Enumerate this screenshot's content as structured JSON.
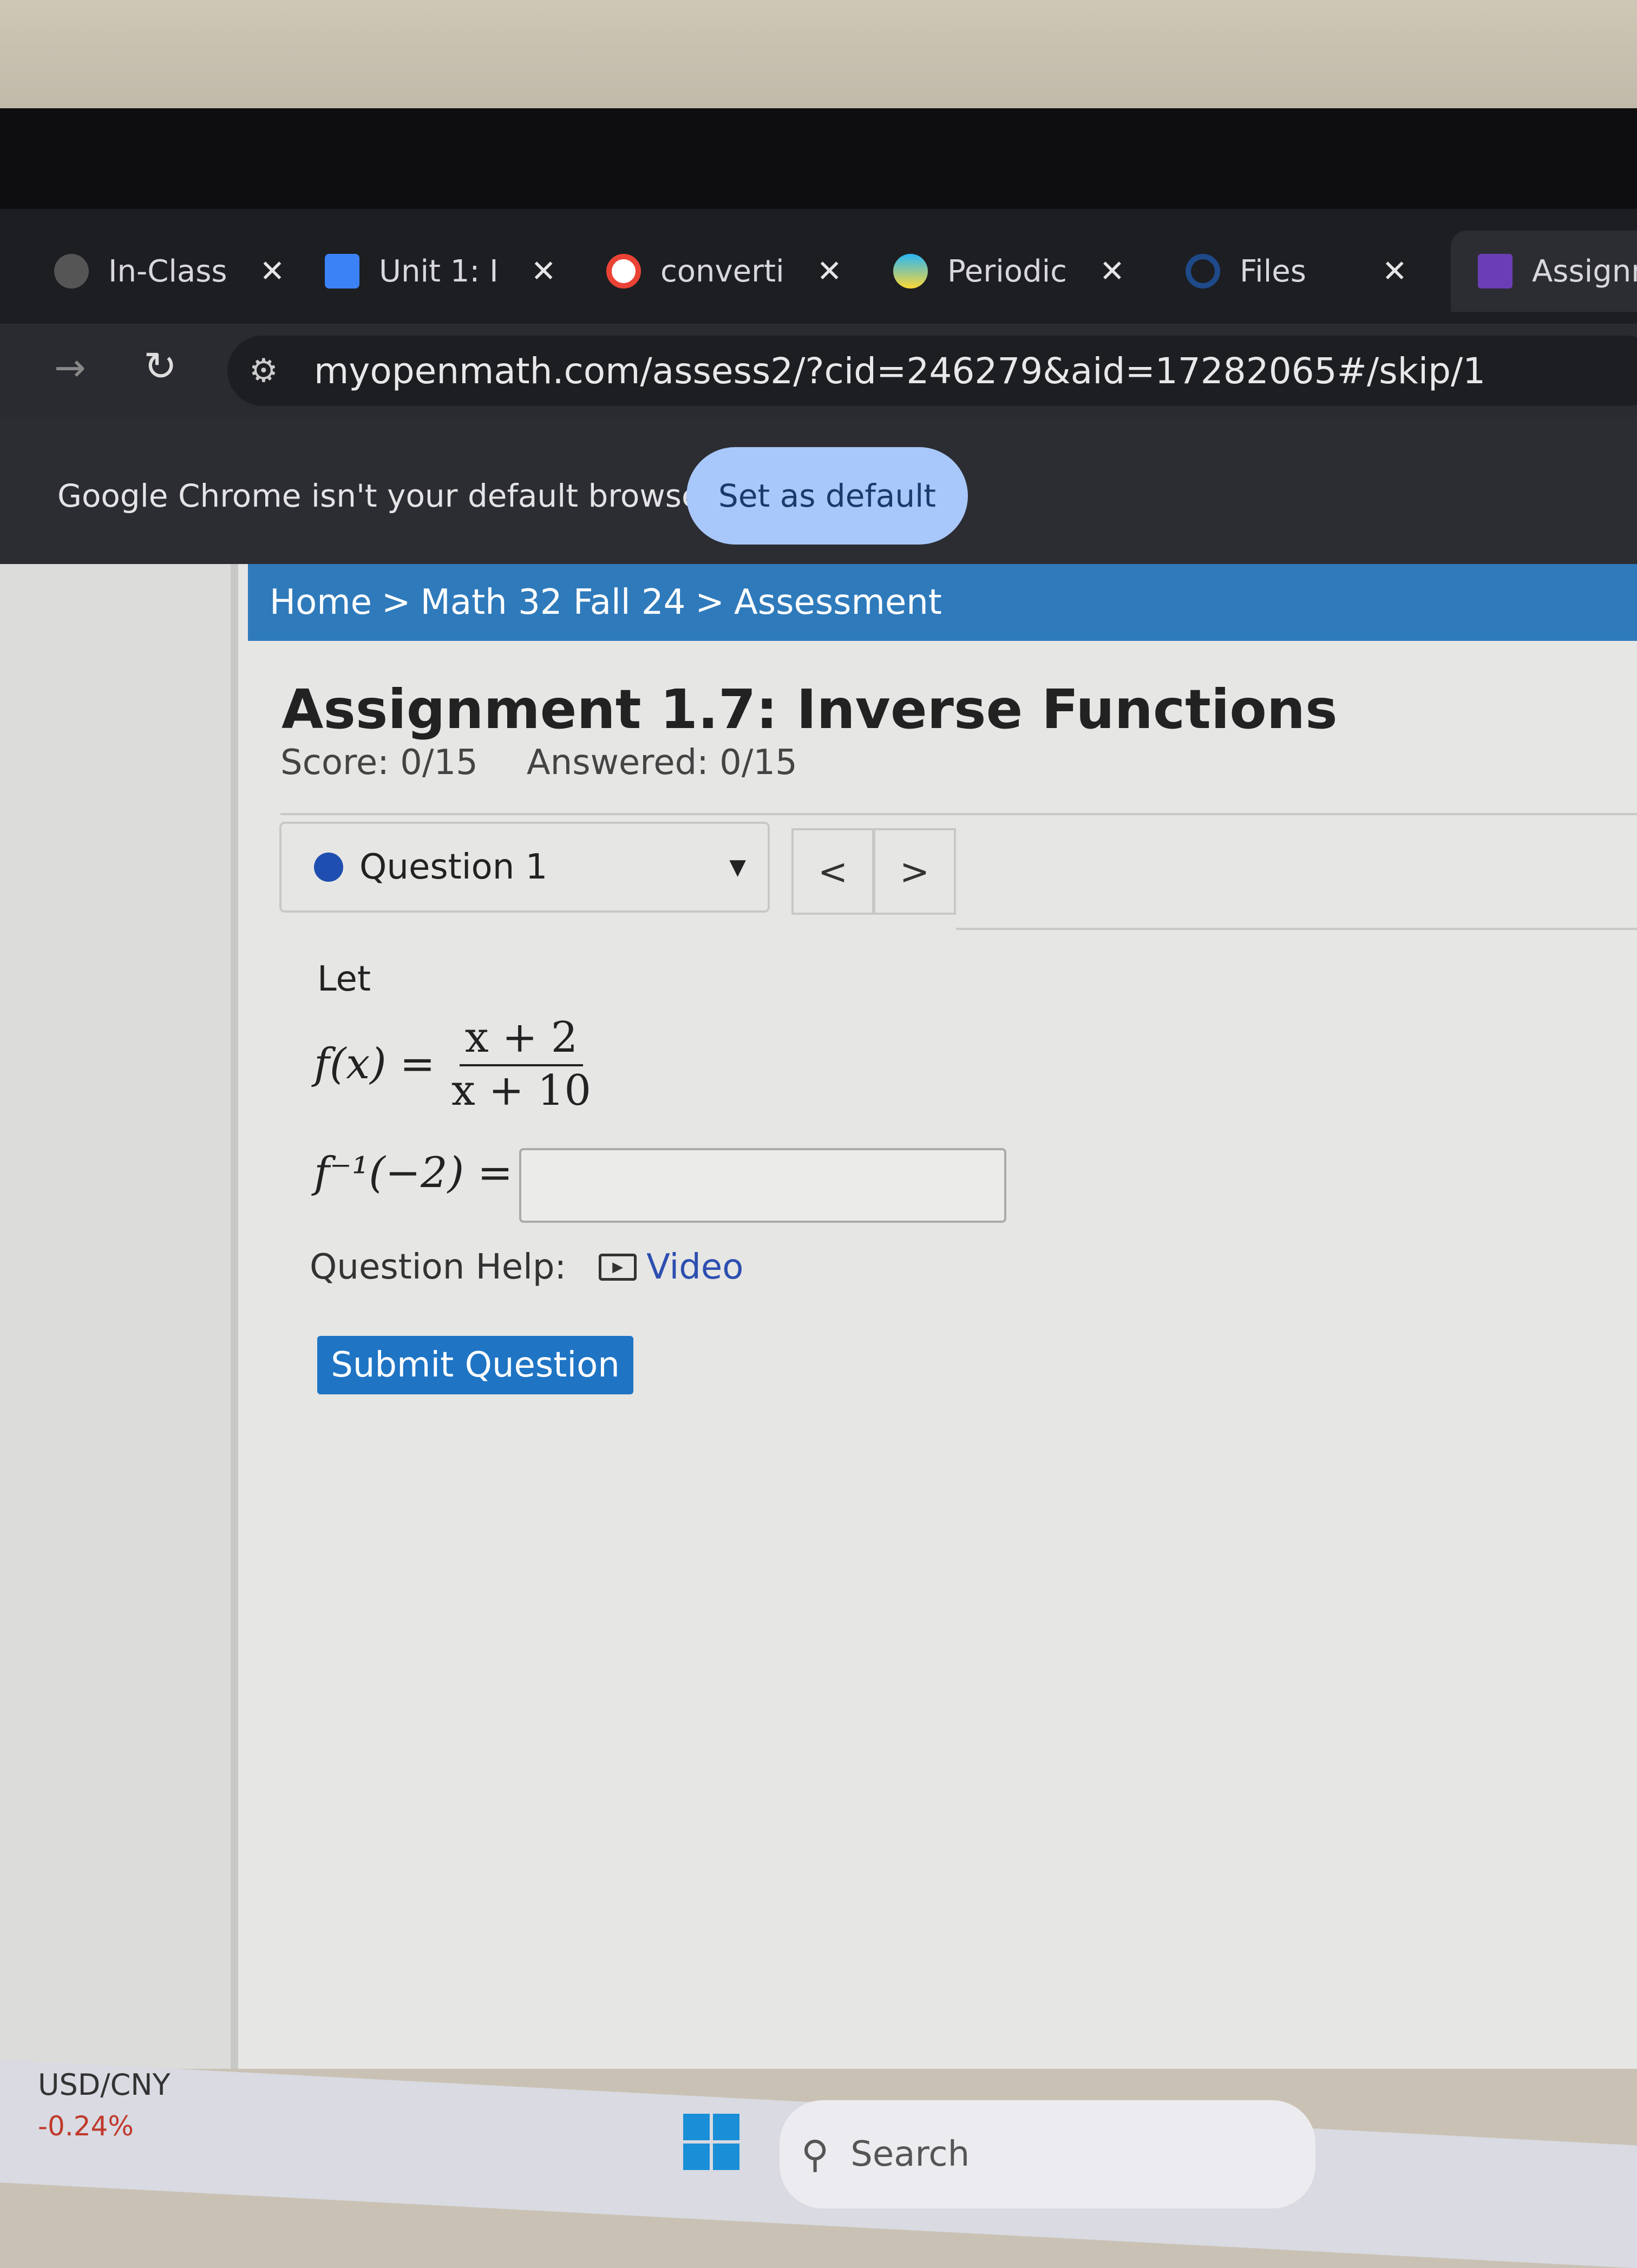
{
  "browser": {
    "tabs": [
      {
        "label": "In-Class",
        "icon": "globe-icon",
        "active": false
      },
      {
        "label": "Unit 1: I",
        "icon": "docs-icon",
        "active": false
      },
      {
        "label": "converti",
        "icon": "google-icon",
        "active": false
      },
      {
        "label": "Periodic",
        "icon": "periodic-icon",
        "active": false
      },
      {
        "label": "Files",
        "icon": "canvas-icon",
        "active": false
      },
      {
        "label": "Assignm",
        "icon": "myopenmath-icon",
        "active": true
      }
    ],
    "close_glyph": "✕",
    "url": "myopenmath.com/assess2/?cid=246279&aid=17282065#/skip/1",
    "infobar": {
      "message": "Google Chrome isn't your default browser",
      "button": "Set as default"
    }
  },
  "breadcrumb": [
    "Home",
    "Math 32 Fall 24",
    "Assessment"
  ],
  "breadcrumb_sep": ">",
  "assignment": {
    "title": "Assignment 1.7: Inverse Functions",
    "score": "Score: 0/15",
    "answered": "Answered: 0/15"
  },
  "question_selector": {
    "label": "Question 1",
    "prev": "<",
    "next": ">"
  },
  "question": {
    "intro": "Let",
    "lhs": "f(x) =",
    "numerator": "x + 2",
    "denominator": "x + 10",
    "prompt": "f⁻¹(−2) =",
    "answer_value": "",
    "help_label": "Question Help:",
    "video_label": "Video",
    "submit_label": "Submit Question"
  },
  "taskbar": {
    "ticker_name": "USD/CNY",
    "ticker_change": "-0.24%",
    "search_placeholder": "Search"
  },
  "colors": {
    "breadcrumb_bg": "#2f7abb",
    "submit_bg": "#1f74c4",
    "link": "#2d4fb0"
  }
}
